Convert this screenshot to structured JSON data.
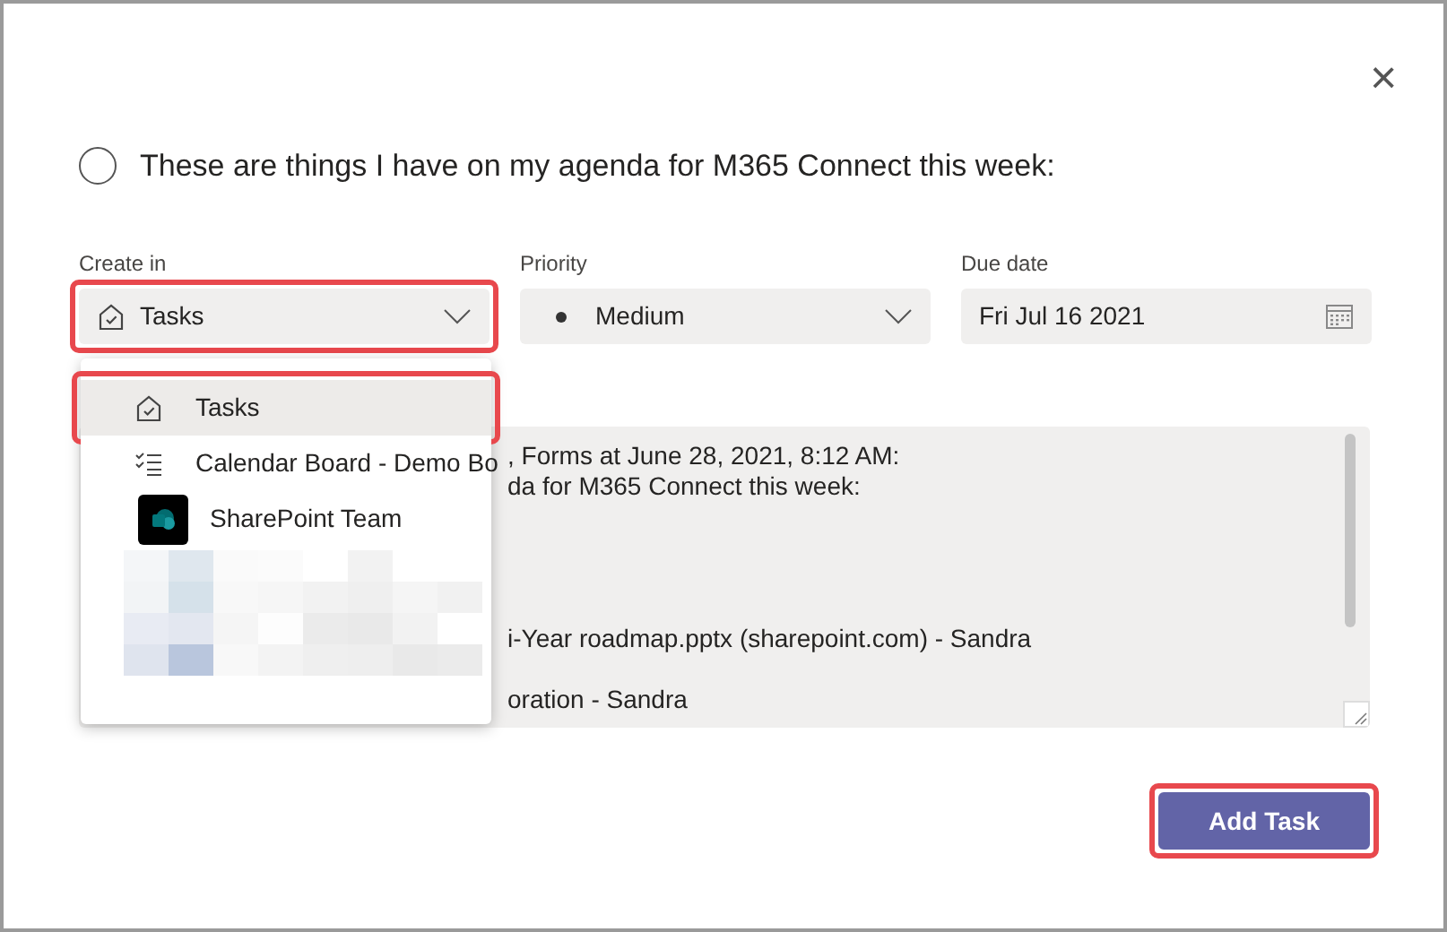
{
  "dialog": {
    "close": "×"
  },
  "task": {
    "title": "These are things I have on my agenda for M365 Connect this week:",
    "checked": false
  },
  "fields": [
    {
      "kind": "select",
      "label": "Create in",
      "value": "Tasks",
      "highlighted": true
    },
    {
      "kind": "priority",
      "label": "Priority",
      "value": "Medium"
    },
    {
      "kind": "date",
      "label": "Due date",
      "value": "Fri Jul 16 2021"
    }
  ],
  "notes": {
    "paragraphs": [
      [
        ", Forms at June 28, 2021, 8:12 AM:",
        "da for M365 Connect this week:"
      ],
      [
        "i-Year roadmap.pptx (sharepoint.com) - Sandra"
      ],
      [
        "oration - Sandra"
      ]
    ]
  },
  "menu": [
    {
      "kind": "tasks",
      "label": "Tasks",
      "selected": true,
      "highlighted": true
    },
    {
      "kind": "board",
      "label": "Calendar Board - Demo Bo",
      "selected": false,
      "highlighted": false
    },
    {
      "kind": "team",
      "label": "SharePoint Team",
      "selected": false,
      "highlighted": false
    }
  ],
  "add_button": {
    "label": "Add Task",
    "highlighted": true
  }
}
